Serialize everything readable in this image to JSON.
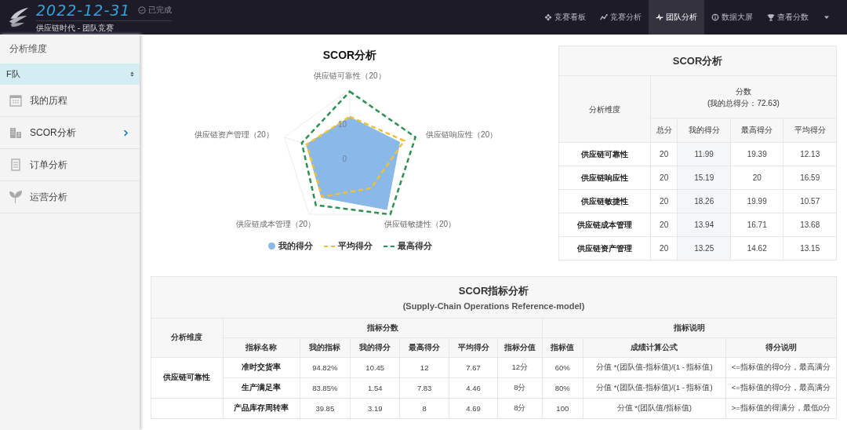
{
  "header": {
    "date": "2022-12-31",
    "status": "已完成",
    "subtitle": "供应链时代 - 团队竞赛"
  },
  "nav": {
    "tabs": [
      {
        "label": "竞赛看板",
        "selected": false
      },
      {
        "label": "竞赛分析",
        "selected": false
      },
      {
        "label": "团队分析",
        "selected": true
      },
      {
        "label": "数据大屏",
        "selected": false
      },
      {
        "label": "查看分数",
        "selected": false
      }
    ]
  },
  "sidebar": {
    "title": "分析维度",
    "team_select": {
      "value": "F队"
    },
    "items": [
      {
        "label": "我的历程",
        "selected": false
      },
      {
        "label": "SCOR分析",
        "selected": true
      },
      {
        "label": "订单分析",
        "selected": false
      },
      {
        "label": "运营分析",
        "selected": false
      }
    ]
  },
  "radar": {
    "title": "SCOR分析",
    "axis_labels": [
      "供应链可靠性（20）",
      "供应链资产管理（20）",
      "供应链响应性（20）",
      "供应链成本管理（20）",
      "供应链敏捷性（20）"
    ],
    "tick_labels": [
      "10",
      "0"
    ],
    "legend": [
      {
        "kind": "area",
        "name": "我的得分",
        "color": "#8ab8e8"
      },
      {
        "kind": "dashed",
        "name": "平均得分",
        "color": "#f0c232"
      },
      {
        "kind": "dashed",
        "name": "最高得分",
        "color": "#2f8f55"
      }
    ]
  },
  "score_table": {
    "title": "SCOR分析",
    "dimension_header": "分析维度",
    "score_header": "分数",
    "total_note": "(我的总得分：72.63)",
    "columns": [
      "总分",
      "我的得分",
      "最高得分",
      "平均得分"
    ],
    "rows": [
      {
        "dimension": "供应链可靠性",
        "cells": [
          "20",
          "11.99",
          "19.39",
          "12.13"
        ]
      },
      {
        "dimension": "供应链响应性",
        "cells": [
          "20",
          "15.19",
          "20",
          "16.59"
        ]
      },
      {
        "dimension": "供应链敏捷性",
        "cells": [
          "20",
          "18.26",
          "19.99",
          "10.57"
        ]
      },
      {
        "dimension": "供应链成本管理",
        "cells": [
          "20",
          "13.94",
          "16.71",
          "13.68"
        ]
      },
      {
        "dimension": "供应链资产管理",
        "cells": [
          "20",
          "13.25",
          "14.62",
          "13.15"
        ]
      }
    ]
  },
  "indicator_table": {
    "title": "SCOR指标分析",
    "subtitle": "(Supply-Chain Operations Reference-model)",
    "dimension_header": "分析维度",
    "group_headers": [
      "指标分数",
      "指标说明"
    ],
    "columns": [
      "指标名称",
      "我的指标",
      "我的得分",
      "最高得分",
      "平均得分",
      "指标分值",
      "指标值",
      "成绩计算公式",
      "得分说明"
    ],
    "groups": [
      {
        "dimension": "供应链可靠性",
        "rows": [
          [
            "准时交货率",
            "94.82%",
            "10.45",
            "12",
            "7.67",
            "12分",
            "60%",
            "分值 *(团队值-指标值)/(1 - 指标值)",
            "<=指标值的得0分，最高满分"
          ],
          [
            "生产满足率",
            "83.85%",
            "1.54",
            "7.83",
            "4.46",
            "8分",
            "80%",
            "分值 *(团队值-指标值)/(1 - 指标值)",
            "<=指标值的得0分，最高满分"
          ]
        ]
      },
      {
        "rows": [
          [
            "产品库存周转率",
            "39.85",
            "3.19",
            "8",
            "4.69",
            "8分",
            "100",
            "分值 *(团队值/指标值)",
            ">=指标值的得满分，最低0分"
          ]
        ]
      }
    ]
  }
}
